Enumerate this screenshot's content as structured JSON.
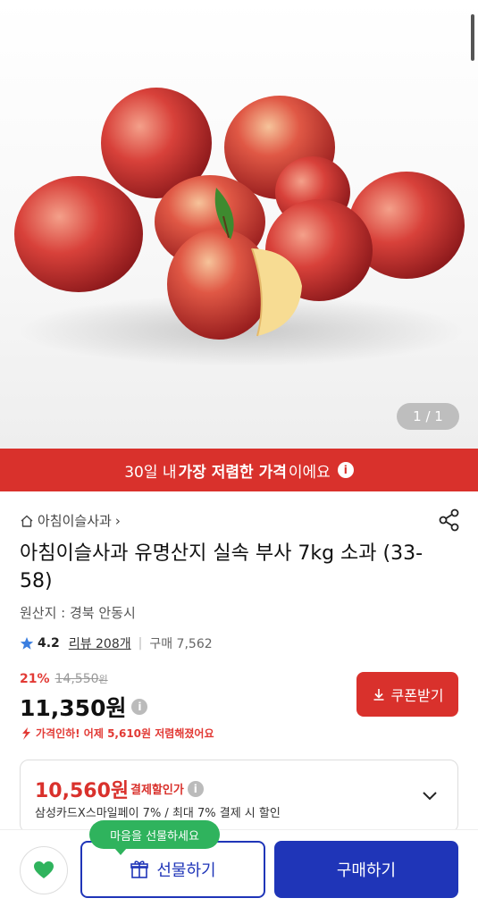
{
  "hero": {
    "image_alt": "apples-product-image",
    "pager": "1 / 1"
  },
  "banner": {
    "prefix": "30일 내 ",
    "highlight": "가장 저렴한 가격",
    "suffix": "이에요"
  },
  "breadcrumb": {
    "store": "아침이슬사과",
    "chevron": "›"
  },
  "product": {
    "title": "아침이슬사과 유명산지 실속 부사 7kg 소과 (33-58)",
    "origin": "원산지 : 경북 안동시",
    "rating": "4.2",
    "reviews": "리뷰 208개",
    "purchases": "구매 7,562"
  },
  "pricing": {
    "discount_rate": "21%",
    "original_price": "14,550",
    "original_unit": "원",
    "price": "11,350원",
    "coupon_label": "쿠폰받기",
    "drop_note": "가격인하! 어제 5,610원 저렴해졌어요"
  },
  "payment": {
    "price": "10,560원",
    "label": "결제할인가",
    "desc": "삼성카드X스마일페이 7% / 최대 7% 결제 시 할인"
  },
  "bottom": {
    "tooltip": "마음을 선물하세요",
    "gift_label": "선물하기",
    "buy_label": "구매하기"
  },
  "colors": {
    "accent_red": "#d9312c",
    "brand_blue": "#1f35b8",
    "tooltip_green": "#2fb35d"
  }
}
